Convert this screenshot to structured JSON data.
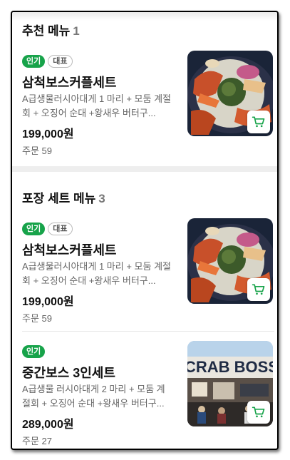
{
  "sections": [
    {
      "title": "추천 메뉴",
      "count": "1"
    },
    {
      "title": "포장 세트 메뉴",
      "count": "3"
    }
  ],
  "items": [
    {
      "badge_popular": "인기",
      "badge_rep": "대표",
      "name": "삼척보스커플세트",
      "desc": "A급생물러시아대게 1 마리 + 모둠 계절회 + 오징어 순대 +왕새우 버터구...",
      "price": "199,000원",
      "orders": "주문 59"
    },
    {
      "badge_popular": "인기",
      "badge_rep": "대표",
      "name": "삼척보스커플세트",
      "desc": "A급생물러시아대게 1 마리 + 모둠 계절회 + 오징어 순대 +왕새우 버터구...",
      "price": "199,000원",
      "orders": "주문 59"
    },
    {
      "badge_popular": "인기",
      "name": "중간보스 3인세트",
      "desc": "A급생물 러시아대게 2 마리 + 모둠 계절회 + 오징어 순대 +왕새우 버터구...",
      "price": "289,000원",
      "orders": "주문 27"
    }
  ],
  "storefront_sign": "CRAB BOSS",
  "colors": {
    "accent": "#17a34a",
    "divider": "#eeeeee"
  },
  "icons": {
    "cart": "cart-icon"
  }
}
